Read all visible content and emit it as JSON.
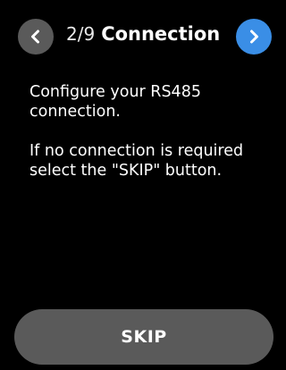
{
  "header": {
    "step": "2/9",
    "title": "Connection",
    "prev_icon": "chevron-left-icon",
    "next_icon": "chevron-right-icon"
  },
  "body": {
    "paragraph_1": "Configure your RS485 connection.",
    "paragraph_2": "If no connection is required select the \"SKIP\" button."
  },
  "skip_button": {
    "label": "SKIP"
  },
  "colors": {
    "background": "#000000",
    "prev_button": "#5a5a5a",
    "next_button": "#3a8ee6",
    "skip_button": "#5a5a5a",
    "text": "#ffffff"
  }
}
